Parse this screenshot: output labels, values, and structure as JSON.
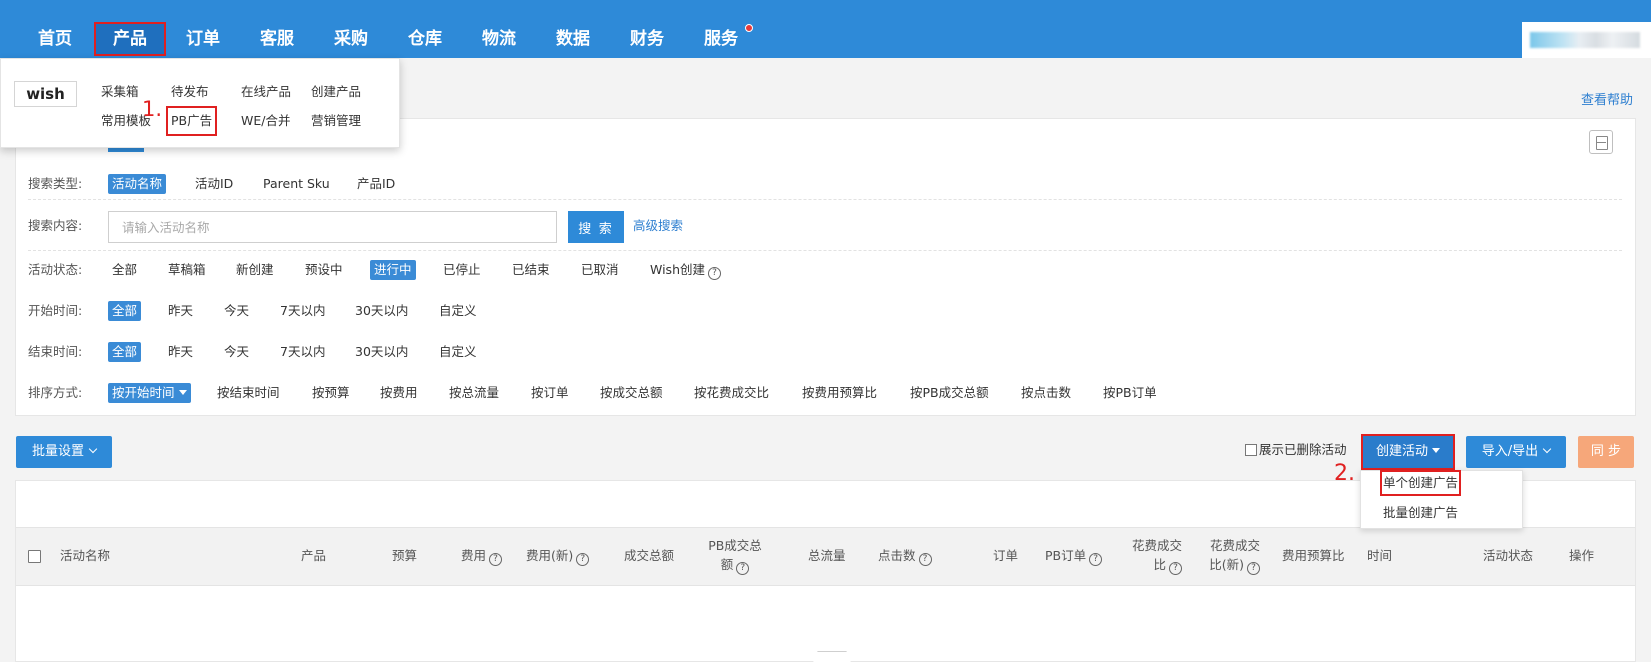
{
  "nav": {
    "items": [
      "首页",
      "产品",
      "订单",
      "客服",
      "采购",
      "仓库",
      "物流",
      "数据",
      "财务",
      "服务"
    ],
    "active": "产品"
  },
  "product_menu": {
    "platform": "wish",
    "row1": [
      "采集箱",
      "待发布",
      "在线产品",
      "创建产品"
    ],
    "row2": [
      "常用模板",
      "PB广告",
      "WE/合并",
      "营销管理"
    ]
  },
  "annotations": {
    "step1": "1.",
    "step2": "2."
  },
  "help": "查看帮助",
  "filters": {
    "search_type_label": "搜索类型:",
    "search_types": [
      "活动名称",
      "活动ID",
      "Parent Sku",
      "产品ID"
    ],
    "search_content_label": "搜索内容:",
    "search_placeholder": "请输入活动名称",
    "search_button": "搜 索",
    "advanced_search": "高级搜索",
    "status_label": "活动状态:",
    "statuses": [
      "全部",
      "草稿箱",
      "新创建",
      "预设中",
      "进行中",
      "已停止",
      "已结束",
      "已取消",
      "Wish创建"
    ],
    "start_label": "开始时间:",
    "start_options": [
      "全部",
      "昨天",
      "今天",
      "7天以内",
      "30天以内",
      "自定义"
    ],
    "end_label": "结束时间:",
    "end_options": [
      "全部",
      "昨天",
      "今天",
      "7天以内",
      "30天以内",
      "自定义"
    ],
    "sort_label": "排序方式:",
    "sort_options": [
      "按开始时间",
      "按结束时间",
      "按预算",
      "按费用",
      "按总流量",
      "按订单",
      "按成交总额",
      "按花费成交比",
      "按费用预算比",
      "按PB成交总额",
      "按点击数",
      "按PB订单"
    ]
  },
  "toolbar": {
    "batch_settings": "批量设置",
    "show_deleted": "展示已删除活动",
    "create_activity": "创建活动",
    "import_export": "导入/导出",
    "sync": "同 步"
  },
  "create_menu": [
    "单个创建广告",
    "批量创建广告"
  ],
  "table": {
    "activity_name": "活动名称",
    "product": "产品",
    "budget": "预算",
    "cost": "费用",
    "cost_new": "费用(新)",
    "total_sales": "成交总额",
    "pb_sales_l1": "PB成交总",
    "pb_sales_l2": "额",
    "total_traffic": "总流量",
    "clicks": "点击数",
    "orders": "订单",
    "pb_orders": "PB订单",
    "cost_ratio_l1": "花费成交",
    "cost_ratio_l2": "比",
    "cost_ratio_new_l1": "花费成交",
    "cost_ratio_new_l2": "比(新)",
    "cost_budget_ratio": "费用预算比",
    "time": "时间",
    "status": "活动状态",
    "actions": "操作"
  }
}
